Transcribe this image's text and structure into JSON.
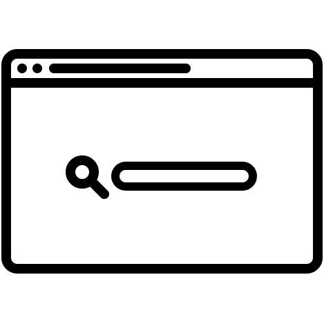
{
  "icon": {
    "name": "browser-search-icon",
    "stroke_color": "#000000",
    "fill_color": "#ffffff",
    "parts": {
      "window": "browser-window-icon",
      "dots": "window-control-dots-icon",
      "address_bar": "address-bar-icon",
      "magnifier": "search-icon",
      "search_field": "search-field-icon"
    }
  }
}
